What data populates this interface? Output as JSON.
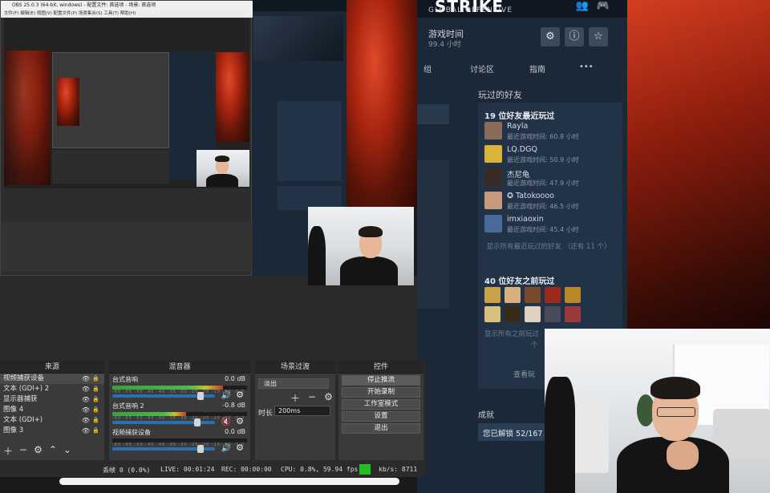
{
  "obs_window": {
    "title": "OBS 25.0.3 (64-bit, windows) - 配置文件: 首选项 - 场景: 首选项",
    "menu": "文件(F)  编辑(E)  视图(V)  配置文件(P)  场景集合(S)  工具(T)  帮助(H)"
  },
  "steam": {
    "game_title": "STRIKE",
    "game_subtitle": "GLOBAL OFFENSIVE",
    "playtime_label": "游戏时间",
    "playtime_value": "99.4 小时",
    "tabs": [
      "组",
      "讨论区",
      "指南",
      "•••"
    ],
    "friends_section_label": "玩过的好友",
    "recent_title": "19 位好友最近玩过",
    "recent_friends": [
      {
        "name": "Rayla",
        "time": "最近游戏时间: 60.8 小时",
        "color": "#8a6a5a"
      },
      {
        "name": "LQ.DGQ",
        "time": "最近游戏时间: 50.9 小时",
        "color": "#d8b43a"
      },
      {
        "name": "杰尼龟",
        "time": "最近游戏时间: 47.9 小时",
        "color": "#3a2a24"
      },
      {
        "name": "✪ Tatokoooo",
        "time": "最近游戏时间: 46.5 小时",
        "color": "#c99a7a"
      },
      {
        "name": "imxiaoxin",
        "time": "最近游戏时间: 45.4 小时",
        "color": "#4a6a9a"
      }
    ],
    "show_all_recent": "显示所有最近玩过的好友 （还有 11 个）",
    "previous_title": "40 位好友之前玩过",
    "previous_avatar_colors": [
      "#c9a24a",
      "#d8b080",
      "#7a4a2a",
      "#9a2a1a",
      "#b8882a",
      "#d8c080",
      "#3a2a1a",
      "#e0d0c0",
      "#4a4a5a",
      "#9a3a3a"
    ],
    "show_all_previous": "显示所有之前玩过",
    "show_all_previous_tail": "个",
    "view_all": "查看玩",
    "achievements_label": "成就",
    "achievements_value": "您已解锁 52/167"
  },
  "obs": {
    "sources_header": "来源",
    "sources": [
      "视频捕获设备",
      "文本 (GDI+) 2",
      "显示器捕获",
      "图像 4",
      "文本 (GDI+)",
      "图像 3"
    ],
    "mixer_header": "混音器",
    "mixer": [
      {
        "name": "台式音响",
        "db": "0.0 dB",
        "level": 0.82,
        "vol": 0.86,
        "muted": false
      },
      {
        "name": "台式音响 2",
        "db": "-0.8 dB",
        "level": 0.55,
        "vol": 0.83,
        "muted": true
      },
      {
        "name": "视频捕获设备",
        "db": "0.0 dB",
        "level": 0.0,
        "vol": 0.86,
        "muted": false
      }
    ],
    "meter_ticks": "-60 -55 -50 -45 -40 -35 -30 -25 -20 -15 -10 -5 0",
    "transitions_header": "场景过渡",
    "transition_value": "淡出",
    "duration_label": "时长",
    "duration_value": "200ms",
    "controls_header": "控件",
    "controls": [
      "停止推流",
      "开始录制",
      "工作室模式",
      "设置",
      "退出"
    ]
  },
  "status": {
    "dropped": "丢帧 0 (0.0%)",
    "live": "LIVE: 00:01:24",
    "rec": "REC: 00:00:00",
    "cpu": "CPU: 0.8%, 59.94 fps",
    "kbs": "kb/s: 8711",
    "indicator_color": "#21c021"
  }
}
